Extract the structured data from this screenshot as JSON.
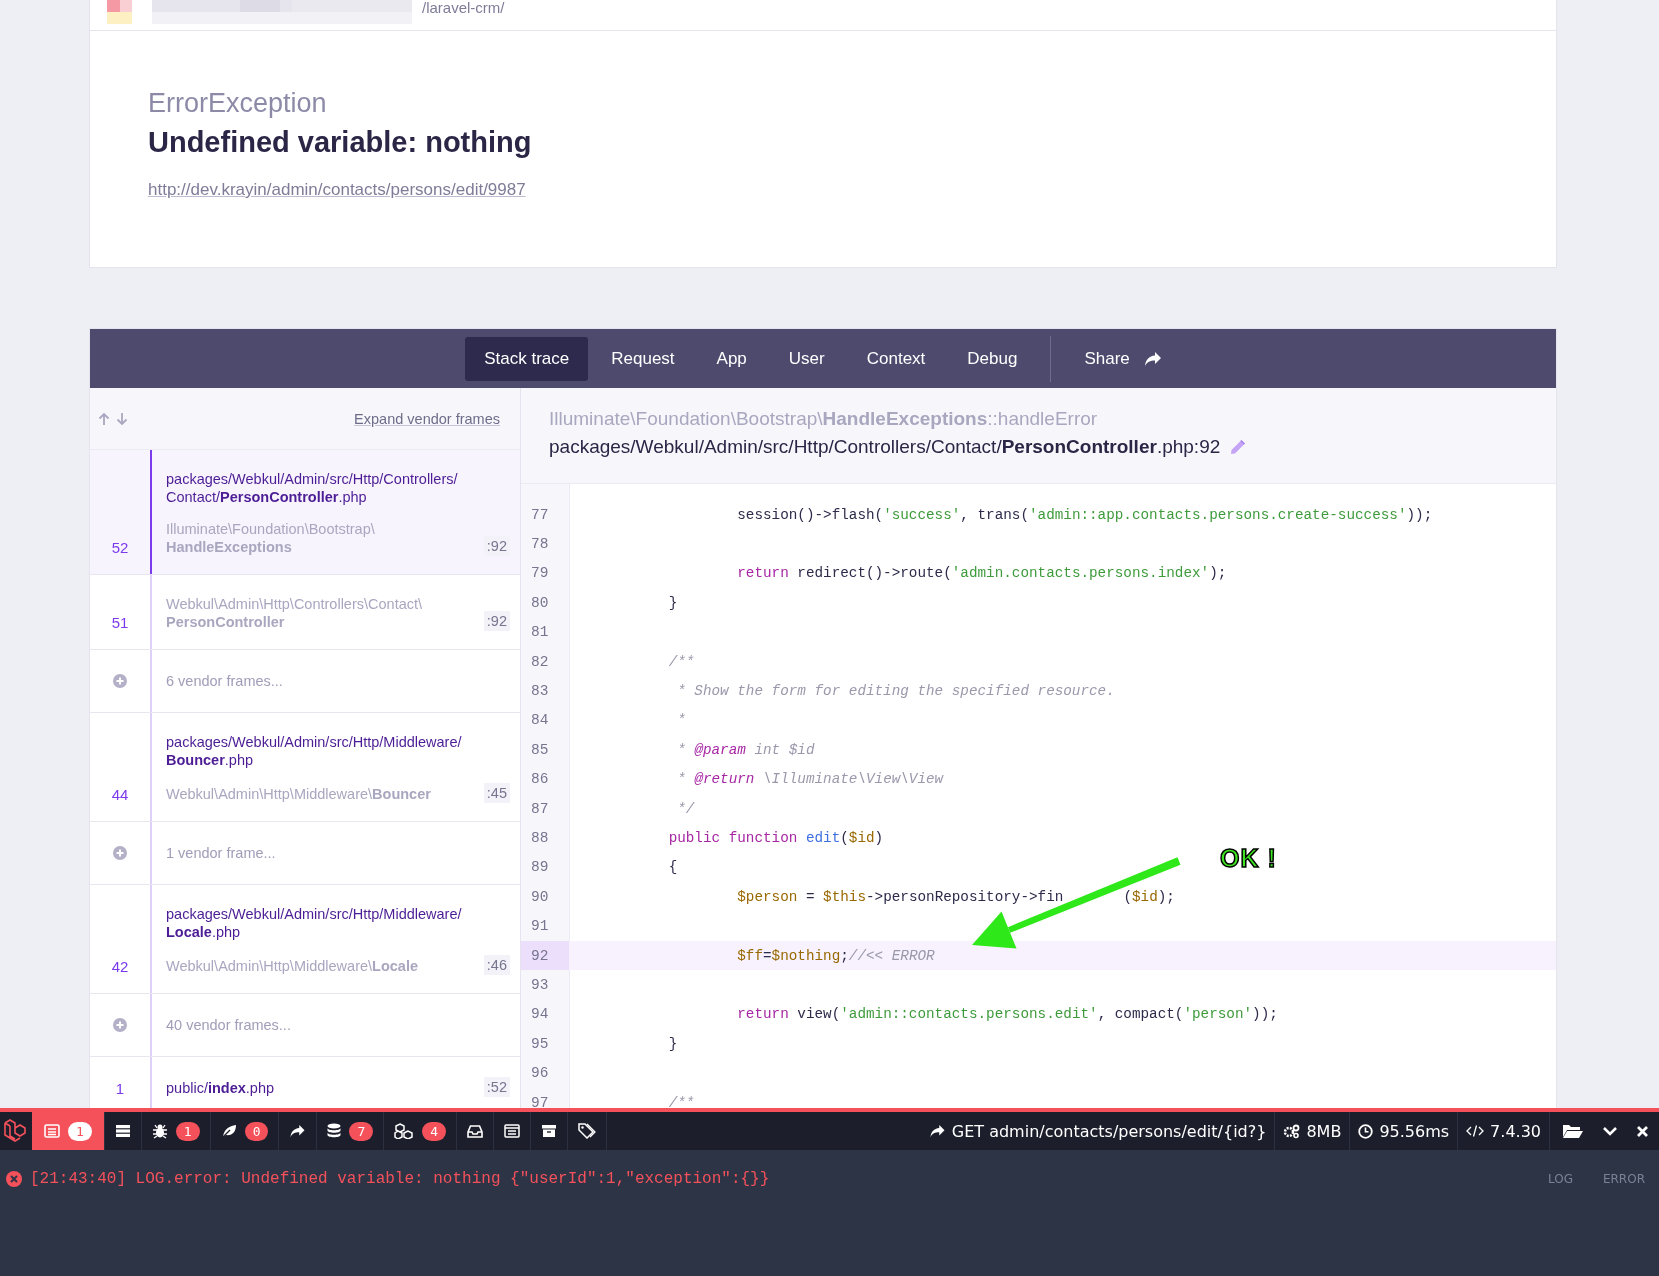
{
  "browser": {
    "address": "/laravel-crm/"
  },
  "error": {
    "type": "ErrorException",
    "message": "Undefined variable: nothing",
    "url": "http://dev.krayin/admin/contacts/persons/edit/9987"
  },
  "tabs": [
    {
      "label": "Stack trace",
      "selected": true
    },
    {
      "label": "Request",
      "selected": false
    },
    {
      "label": "App",
      "selected": false
    },
    {
      "label": "User",
      "selected": false
    },
    {
      "label": "Context",
      "selected": false
    },
    {
      "label": "Debug",
      "selected": false
    }
  ],
  "share": {
    "label": "Share"
  },
  "frames_toolbar": {
    "expand_label": "Expand vendor frames"
  },
  "frames": [
    {
      "kind": "frame",
      "number": "52",
      "file": "packages/Webkul/Admin/src/Http/Controllers/Contact/**PersonController**.php",
      "class": "Illuminate\\Foundation\\Bootstrap\\**HandleExceptions**",
      "line": ":92",
      "selected": true
    },
    {
      "kind": "frame",
      "number": "51",
      "class": "Webkul\\Admin\\Http\\Controllers\\Contact\\**PersonController**",
      "line": ":92",
      "selected": false
    },
    {
      "kind": "vendor",
      "label": "6 vendor frames..."
    },
    {
      "kind": "frame",
      "number": "44",
      "file": "packages/Webkul/Admin/src/Http/Middleware/**Bouncer**.php",
      "class": "Webkul\\Admin\\Http\\Middleware\\**Bouncer**",
      "line": ":45",
      "selected": false
    },
    {
      "kind": "vendor",
      "label": "1 vendor frame..."
    },
    {
      "kind": "frame",
      "number": "42",
      "file": "packages/Webkul/Admin/src/Http/Middleware/**Locale**.php",
      "class": "Webkul\\Admin\\Http\\Middleware\\**Locale**",
      "line": ":46",
      "selected": false
    },
    {
      "kind": "vendor",
      "label": "40 vendor frames..."
    },
    {
      "kind": "frame",
      "number": "1",
      "file": "public/**index**.php",
      "line": ":52",
      "selected": false
    }
  ],
  "source": {
    "class": "Illuminate\\Foundation\\Bootstrap\\**HandleExceptions**::handleError",
    "path": "packages/Webkul/Admin/src/Http/Controllers/Contact/**PersonController**.php:92",
    "lines": [
      {
        "number": "77",
        "highlighted": false,
        "tokens": [
          {
            "kind": "plain",
            "text": "                session()->flash("
          },
          {
            "kind": "string",
            "text": "'success'"
          },
          {
            "kind": "plain",
            "text": ", trans("
          },
          {
            "kind": "string",
            "text": "'admin::app.contacts.persons.create-success'"
          },
          {
            "kind": "plain",
            "text": "));"
          }
        ]
      },
      {
        "number": "78",
        "highlighted": false
      },
      {
        "number": "79",
        "highlighted": false,
        "tokens": [
          {
            "kind": "keyword",
            "text": "                return"
          },
          {
            "kind": "plain",
            "text": " redirect()->route("
          },
          {
            "kind": "string",
            "text": "'admin.contacts.persons.index'"
          },
          {
            "kind": "plain",
            "text": ");"
          }
        ]
      },
      {
        "number": "80",
        "highlighted": false,
        "tokens": [
          {
            "kind": "plain",
            "text": "        }"
          }
        ]
      },
      {
        "number": "81",
        "highlighted": false
      },
      {
        "number": "82",
        "highlighted": false,
        "tokens": [
          {
            "kind": "comment",
            "text": "        /**"
          }
        ]
      },
      {
        "number": "83",
        "highlighted": false,
        "tokens": [
          {
            "kind": "comment",
            "text": "         * Show the form for editing the specified resource."
          }
        ]
      },
      {
        "number": "84",
        "highlighted": false,
        "tokens": [
          {
            "kind": "comment",
            "text": "         *"
          }
        ]
      },
      {
        "number": "85",
        "highlighted": false,
        "tokens": [
          {
            "kind": "comment",
            "text": "         * "
          },
          {
            "kind": "doctag",
            "text": "@param"
          },
          {
            "kind": "comment",
            "text": " int $id"
          }
        ]
      },
      {
        "number": "86",
        "highlighted": false,
        "tokens": [
          {
            "kind": "comment",
            "text": "         * "
          },
          {
            "kind": "doctag",
            "text": "@return"
          },
          {
            "kind": "comment",
            "text": " \\Illuminate\\View\\View"
          }
        ]
      },
      {
        "number": "87",
        "highlighted": false,
        "tokens": [
          {
            "kind": "comment",
            "text": "         */"
          }
        ]
      },
      {
        "number": "88",
        "highlighted": false,
        "tokens": [
          {
            "kind": "keyword",
            "text": "        public function"
          },
          {
            "kind": "func",
            "text": " edit"
          },
          {
            "kind": "plain",
            "text": "("
          },
          {
            "kind": "var",
            "text": "$id"
          },
          {
            "kind": "plain",
            "text": ")"
          }
        ]
      },
      {
        "number": "89",
        "highlighted": false,
        "tokens": [
          {
            "kind": "plain",
            "text": "        {"
          }
        ]
      },
      {
        "number": "90",
        "highlighted": false,
        "tokens": [
          {
            "kind": "var",
            "text": "                $person"
          },
          {
            "kind": "plain",
            "text": " = "
          },
          {
            "kind": "var",
            "text": "$this"
          },
          {
            "kind": "plain",
            "text": "->personRepository->fin"
          },
          {
            "kind": "gap"
          },
          {
            "kind": "plain",
            "text": "("
          },
          {
            "kind": "var",
            "text": "$id"
          },
          {
            "kind": "plain",
            "text": ");"
          }
        ]
      },
      {
        "number": "91",
        "highlighted": false
      },
      {
        "number": "92",
        "highlighted": true,
        "tokens": [
          {
            "kind": "var",
            "text": "                $ff"
          },
          {
            "kind": "plain",
            "text": "="
          },
          {
            "kind": "var",
            "text": "$nothing"
          },
          {
            "kind": "plain",
            "text": ";"
          },
          {
            "kind": "comment",
            "text": "//<< ERROR"
          }
        ]
      },
      {
        "number": "93",
        "highlighted": false
      },
      {
        "number": "94",
        "highlighted": false,
        "tokens": [
          {
            "kind": "keyword",
            "text": "                return"
          },
          {
            "kind": "plain",
            "text": " view("
          },
          {
            "kind": "string",
            "text": "'admin::contacts.persons.edit'"
          },
          {
            "kind": "plain",
            "text": ", compact("
          },
          {
            "kind": "string",
            "text": "'person'"
          },
          {
            "kind": "plain",
            "text": "));"
          }
        ]
      },
      {
        "number": "95",
        "highlighted": false,
        "tokens": [
          {
            "kind": "plain",
            "text": "        }"
          }
        ]
      },
      {
        "number": "96",
        "highlighted": false
      },
      {
        "number": "97",
        "highlighted": false,
        "tokens": [
          {
            "kind": "comment",
            "text": "        /**"
          }
        ]
      }
    ]
  },
  "annotation": {
    "label": "OK !"
  },
  "debugbar": {
    "tabs": [
      {
        "badge": "1",
        "selected": true
      },
      {
        "selected": false
      },
      {
        "badge": "1",
        "selected": false
      },
      {
        "badge": "0",
        "selected": false
      },
      {
        "selected": false
      },
      {
        "badge": "7",
        "selected": false
      },
      {
        "badge": "4",
        "selected": false
      },
      {
        "selected": false
      },
      {
        "selected": false
      },
      {
        "selected": false
      },
      {
        "selected": false
      }
    ],
    "route": "GET admin/contacts/persons/edit/{id?}",
    "memory": "8MB",
    "duration": "95.56ms",
    "php_version": "7.4.30"
  },
  "log": {
    "entries": [
      "[21:43:40] LOG.error: Undefined variable: nothing {\"userId\":1,\"exception\":{}}"
    ],
    "labels": [
      "LOG",
      "ERROR"
    ]
  }
}
